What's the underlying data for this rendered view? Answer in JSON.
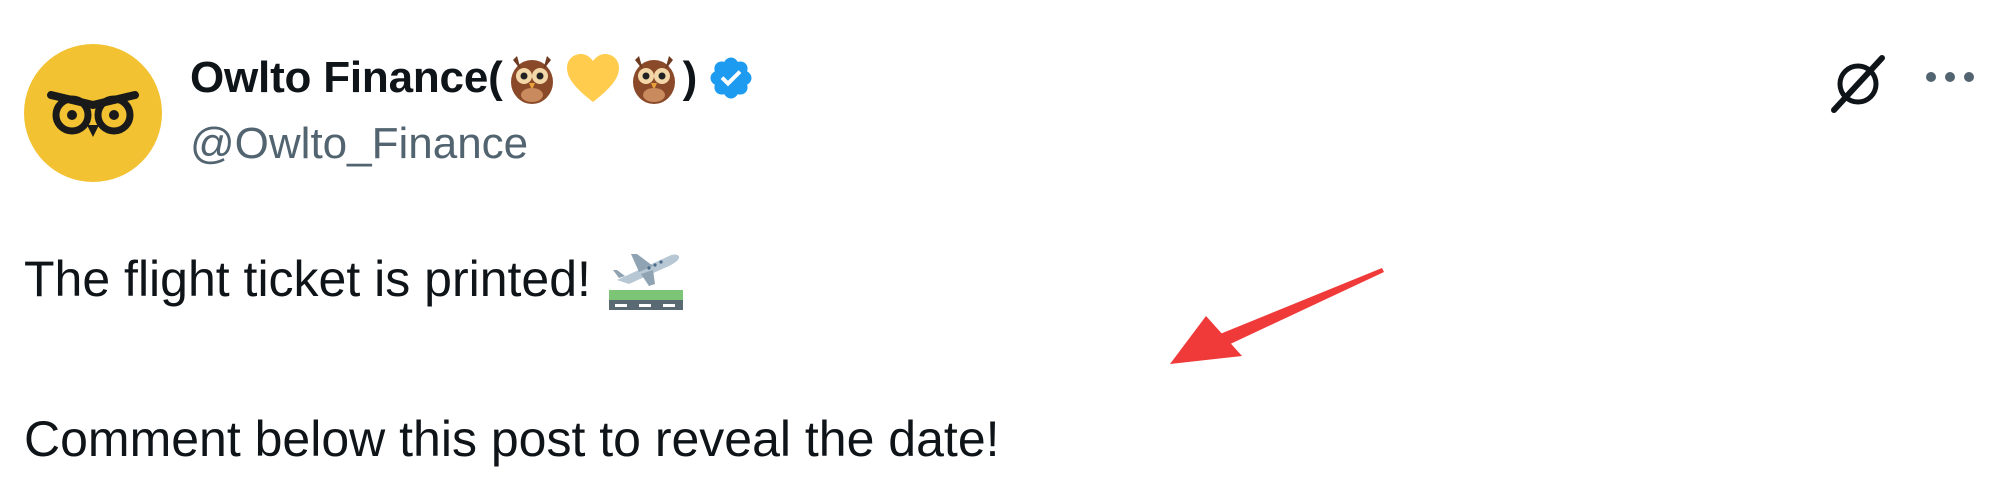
{
  "author": {
    "display_name": "Owlto Finance(",
    "display_name_suffix": ")",
    "name_emojis": [
      "owl",
      "yellow-heart",
      "owl"
    ],
    "handle": "@Owlto_Finance",
    "verified": true,
    "avatar_color": "#f2c232"
  },
  "post": {
    "line1": "The flight ticket is printed!",
    "line1_emoji": "airplane-departure",
    "line2": "Comment below this post to reveal the date!"
  },
  "colors": {
    "text": "#0f1419",
    "secondary_text": "#536471",
    "verified_badge": "#1d9bf0",
    "annotation_arrow": "#f03a3a"
  }
}
